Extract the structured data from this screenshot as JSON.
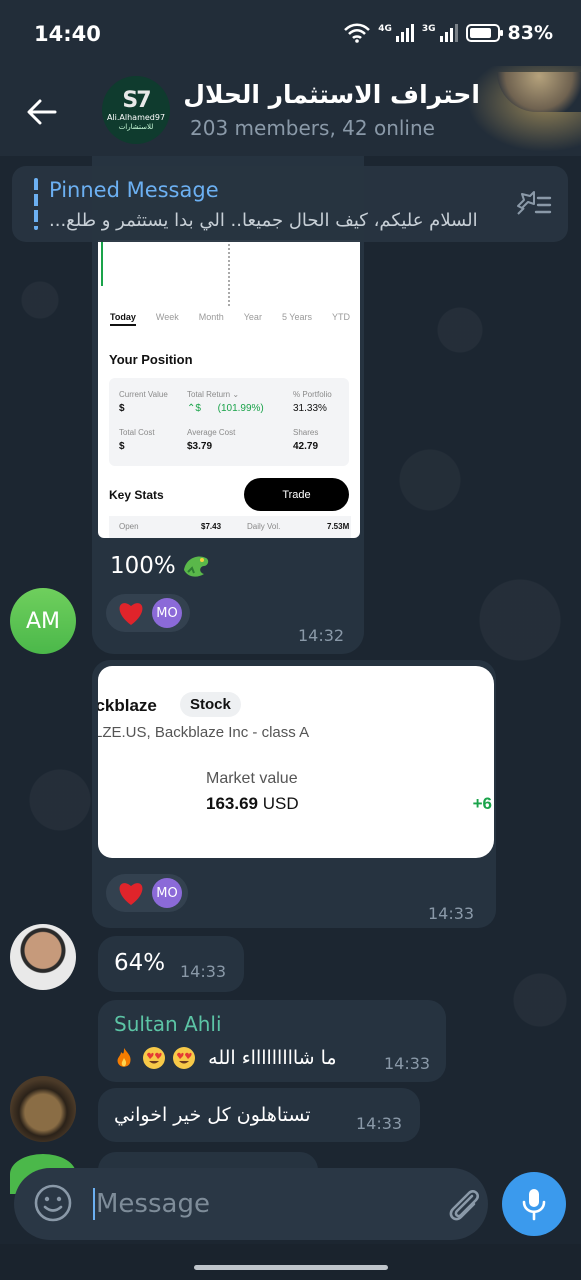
{
  "status_bar": {
    "time": "14:40",
    "net1": "4G",
    "net2": "3G",
    "battery": "83%",
    "battery_level": 0.83
  },
  "header": {
    "title": "احتراف الاستثمار الحلال",
    "subtitle": "203 members, 42 online",
    "logo_text": "Ali.Alhamed97",
    "logo_sub": "للاستشارات"
  },
  "pinned": {
    "label": "Pinned Message",
    "text": "السلام عليكم، كيف الحال جميعا.. الي بدا يستثمر و طلع..."
  },
  "msg1": {
    "card": {
      "periods": [
        "Today",
        "Week",
        "Month",
        "Year",
        "5 Years",
        "YTD"
      ],
      "your_position": "Your Position",
      "current_value_label": "Current Value",
      "current_value": "$",
      "total_return_label": "Total Return ⌄",
      "total_return_value": "⌃$",
      "total_return_pct": "(101.99%)",
      "portfolio_label": "% Portfolio",
      "portfolio_value": "31.33%",
      "total_cost_label": "Total Cost",
      "total_cost_value": "$",
      "avg_cost_label": "Average Cost",
      "avg_cost_value": "$3.79",
      "shares_label": "Shares",
      "shares_value": "42.79",
      "key_stats": "Key Stats",
      "trade": "Trade",
      "open_label": "Open",
      "open_value": "$7.43",
      "daily_vol_label": "Daily Vol.",
      "daily_vol_value": "7.53M"
    },
    "text": "100%",
    "reaction_avatar": "MO",
    "time": "14:32"
  },
  "am_avatar": "AM",
  "msg2": {
    "name": "ackblaze",
    "badge": "Stock",
    "description": "LZE.US, Backblaze Inc - class A",
    "market_value_label": "Market value",
    "market_value": "163.69",
    "currency": "USD",
    "change": "+6",
    "reaction_avatar": "MO",
    "time": "14:33"
  },
  "msg3": {
    "text": "64%",
    "time": "14:33"
  },
  "msg4": {
    "sender": "Sultan Ahli",
    "text": "ما شاااااااااء الله",
    "time": "14:33"
  },
  "msg5": {
    "text": "تستاهلون كل خير اخواني",
    "time": "14:33"
  },
  "composer": {
    "placeholder": "Message"
  },
  "colors": {
    "accent": "#3b9aed",
    "pinned_label": "#6cb0f2",
    "sender_name": "#5cc4a5",
    "positive": "#1aa34a",
    "reaction_avatar": "#8b6ad8"
  }
}
